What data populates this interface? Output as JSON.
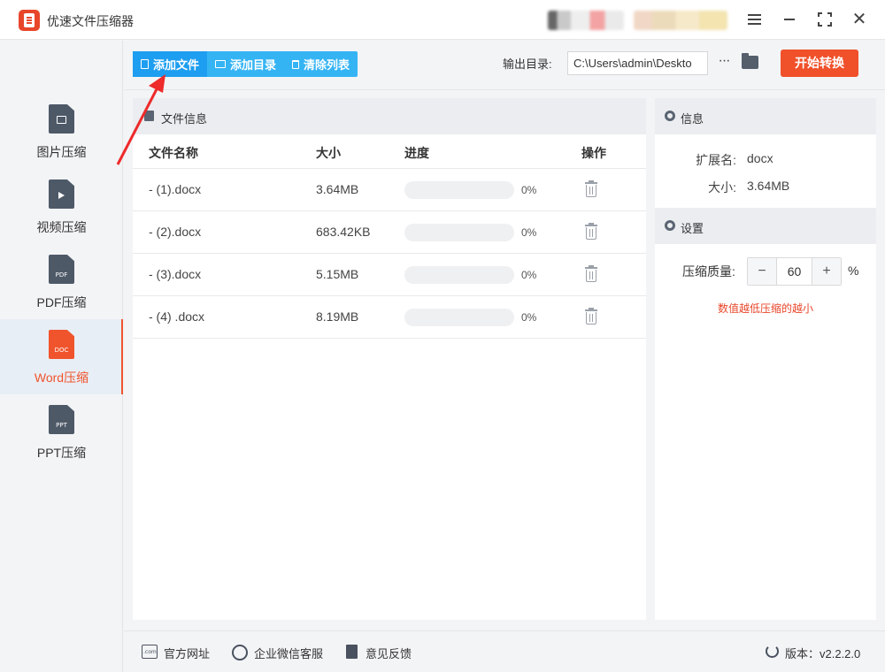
{
  "app": {
    "title": "优速文件压缩器"
  },
  "sidebar": {
    "items": [
      {
        "label": "图片压缩",
        "icon": "image-file-icon"
      },
      {
        "label": "视频压缩",
        "icon": "video-file-icon"
      },
      {
        "label": "PDF压缩",
        "icon": "pdf-file-icon",
        "tag": "PDF"
      },
      {
        "label": "Word压缩",
        "icon": "doc-file-icon",
        "tag": "DOC",
        "active": true
      },
      {
        "label": "PPT压缩",
        "icon": "ppt-file-icon",
        "tag": "PPT"
      }
    ]
  },
  "toolbar": {
    "add_file": "添加文件",
    "add_dir": "添加目录",
    "clear_list": "清除列表",
    "output_label": "输出目录:",
    "output_path": "C:\\Users\\admin\\Deskto",
    "more": "···",
    "start": "开始转换"
  },
  "file_panel": {
    "title": "文件信息",
    "columns": {
      "name": "文件名称",
      "size": "大小",
      "progress": "进度",
      "action": "操作"
    },
    "rows": [
      {
        "name": "- (1).docx",
        "size": "3.64MB",
        "progress": 0,
        "percent": "0%"
      },
      {
        "name": "- (2).docx",
        "size": "683.42KB",
        "progress": 0,
        "percent": "0%"
      },
      {
        "name": "- (3).docx",
        "size": "5.15MB",
        "progress": 0,
        "percent": "0%"
      },
      {
        "name": "- (4) .docx",
        "size": "8.19MB",
        "progress": 0,
        "percent": "0%"
      }
    ]
  },
  "info_panel": {
    "title": "信息",
    "ext_label": "扩展名:",
    "ext_value": "docx",
    "size_label": "大小:",
    "size_value": "3.64MB"
  },
  "settings_panel": {
    "title": "设置",
    "quality_label": "压缩质量:",
    "quality_value": "60",
    "minus": "−",
    "plus": "+",
    "percent": "%",
    "hint": "数值越低压缩的越小"
  },
  "footer": {
    "website": "官方网址",
    "wechat": "企业微信客服",
    "feedback": "意见反馈",
    "version": "版本：v2.2.2.0"
  },
  "colors": {
    "accent": "#f0502a",
    "primary": "#35b4f4",
    "primary_dark": "#1e9ef0"
  }
}
